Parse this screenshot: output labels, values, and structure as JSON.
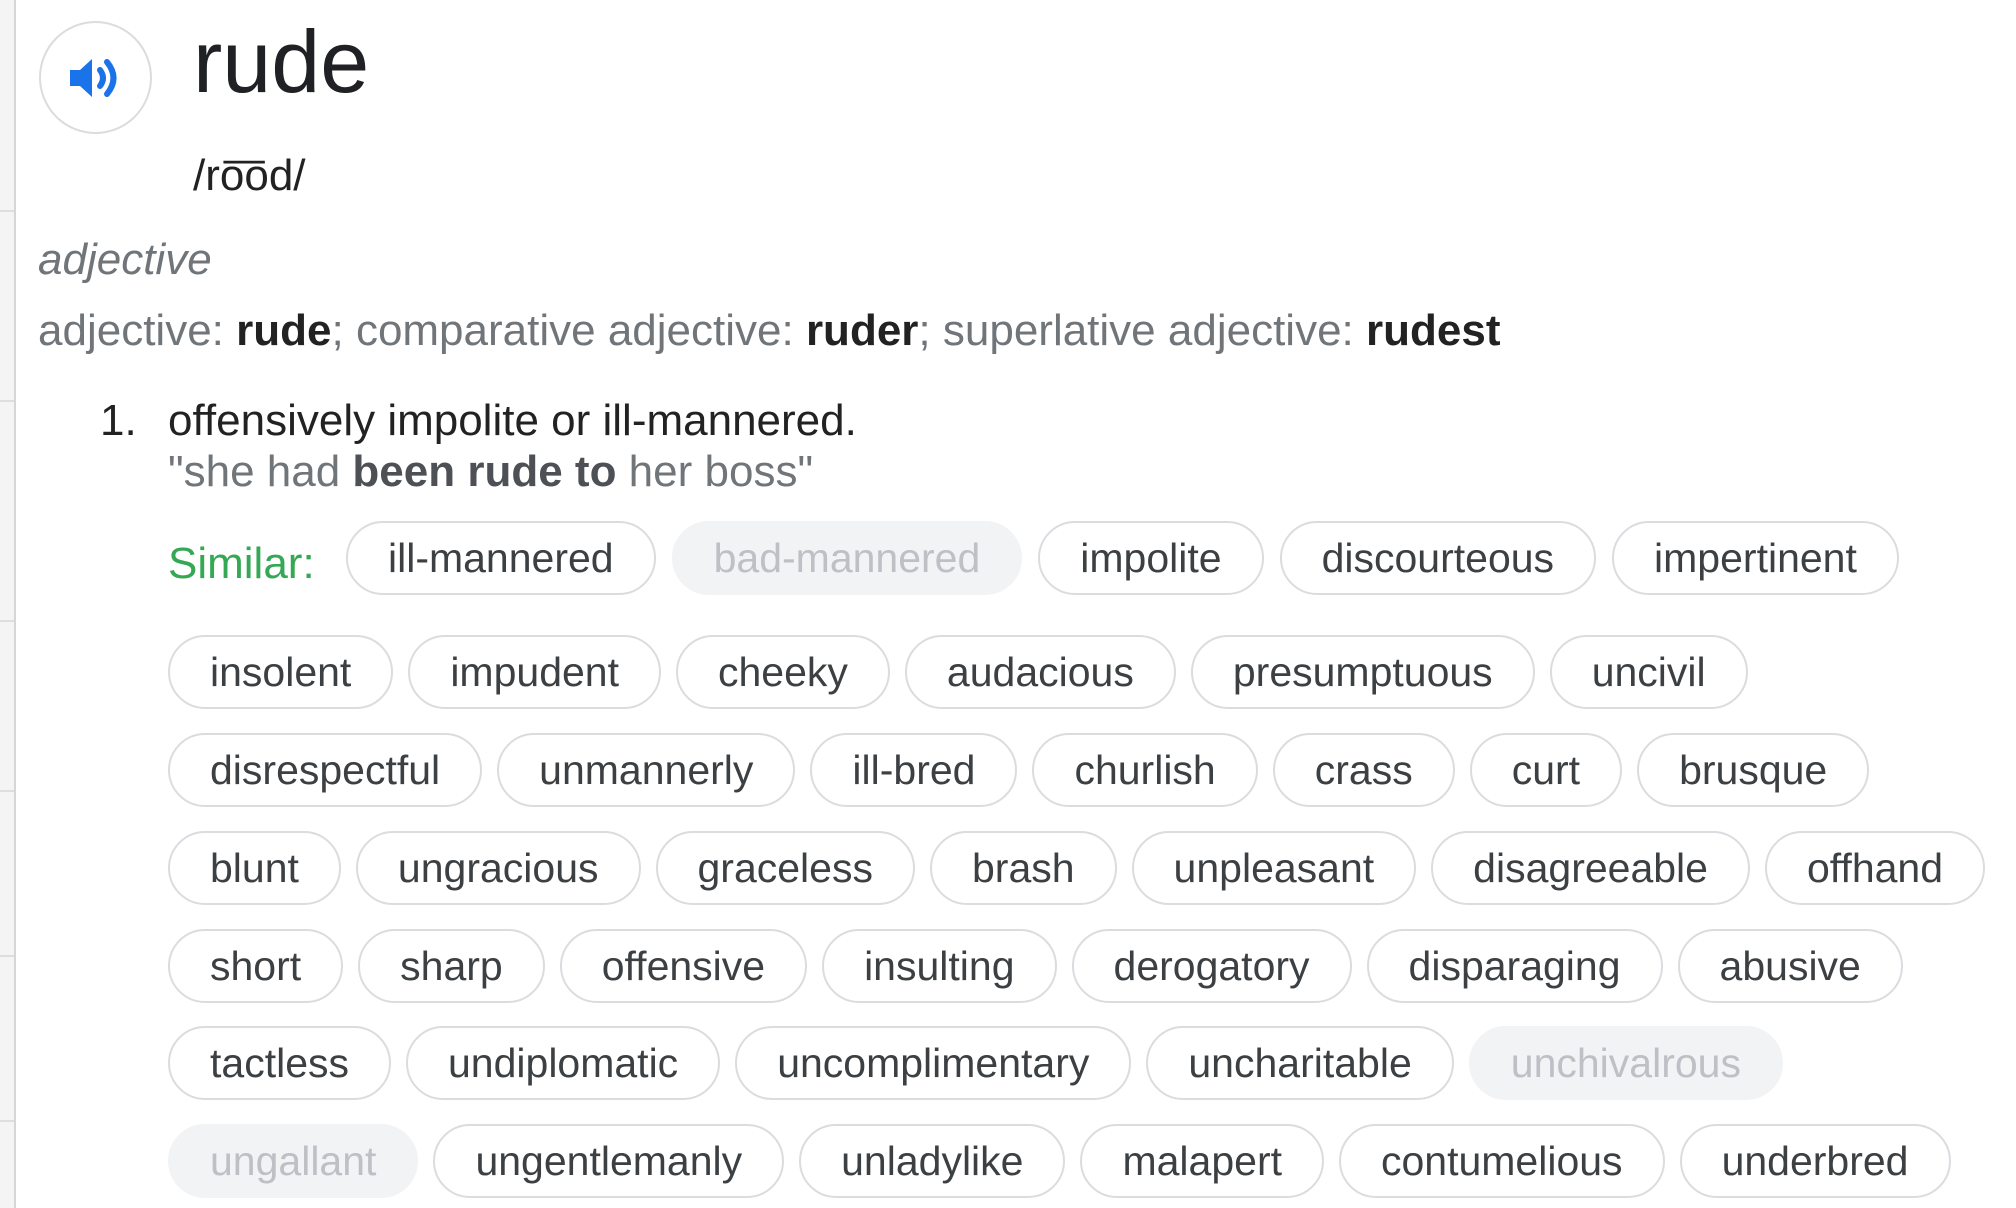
{
  "entry": {
    "word": "rude",
    "phonetic": "/ro͞od/",
    "part_of_speech": "adjective",
    "forms": {
      "base_label": "adjective",
      "base_value": "rude",
      "comparative_label": "comparative adjective",
      "comparative_value": "ruder",
      "superlative_label": "superlative adjective",
      "superlative_value": "rudest"
    },
    "speaker_icon": "speaker-volume-icon",
    "accent_color": "#1a73e8"
  },
  "sense": {
    "number": "1.",
    "definition": "offensively impolite or ill-mannered.",
    "example_prefix": "\"she had ",
    "example_bold": "been rude to",
    "example_suffix": " her boss\""
  },
  "similar": {
    "label": "Similar:",
    "label_color": "#34a853",
    "rows": [
      [
        {
          "text": "ill-mannered",
          "disabled": false
        },
        {
          "text": "bad-mannered",
          "disabled": true
        },
        {
          "text": "impolite",
          "disabled": false
        },
        {
          "text": "discourteous",
          "disabled": false
        },
        {
          "text": "impertinent",
          "disabled": false
        }
      ],
      [
        {
          "text": "insolent",
          "disabled": false
        },
        {
          "text": "impudent",
          "disabled": false
        },
        {
          "text": "cheeky",
          "disabled": false
        },
        {
          "text": "audacious",
          "disabled": false
        },
        {
          "text": "presumptuous",
          "disabled": false
        },
        {
          "text": "uncivil",
          "disabled": false
        }
      ],
      [
        {
          "text": "disrespectful",
          "disabled": false
        },
        {
          "text": "unmannerly",
          "disabled": false
        },
        {
          "text": "ill-bred",
          "disabled": false
        },
        {
          "text": "churlish",
          "disabled": false
        },
        {
          "text": "crass",
          "disabled": false
        },
        {
          "text": "curt",
          "disabled": false
        },
        {
          "text": "brusque",
          "disabled": false
        }
      ],
      [
        {
          "text": "blunt",
          "disabled": false
        },
        {
          "text": "ungracious",
          "disabled": false
        },
        {
          "text": "graceless",
          "disabled": false
        },
        {
          "text": "brash",
          "disabled": false
        },
        {
          "text": "unpleasant",
          "disabled": false
        },
        {
          "text": "disagreeable",
          "disabled": false
        },
        {
          "text": "offhand",
          "disabled": false
        }
      ],
      [
        {
          "text": "short",
          "disabled": false
        },
        {
          "text": "sharp",
          "disabled": false
        },
        {
          "text": "offensive",
          "disabled": false
        },
        {
          "text": "insulting",
          "disabled": false
        },
        {
          "text": "derogatory",
          "disabled": false
        },
        {
          "text": "disparaging",
          "disabled": false
        },
        {
          "text": "abusive",
          "disabled": false
        }
      ],
      [
        {
          "text": "tactless",
          "disabled": false
        },
        {
          "text": "undiplomatic",
          "disabled": false
        },
        {
          "text": "uncomplimentary",
          "disabled": false
        },
        {
          "text": "uncharitable",
          "disabled": false
        },
        {
          "text": "unchivalrous",
          "disabled": true
        }
      ],
      [
        {
          "text": "ungallant",
          "disabled": true
        },
        {
          "text": "ungentlemanly",
          "disabled": false
        },
        {
          "text": "unladylike",
          "disabled": false
        },
        {
          "text": "malapert",
          "disabled": false
        },
        {
          "text": "contumelious",
          "disabled": false
        },
        {
          "text": "underbred",
          "disabled": false
        }
      ]
    ]
  }
}
